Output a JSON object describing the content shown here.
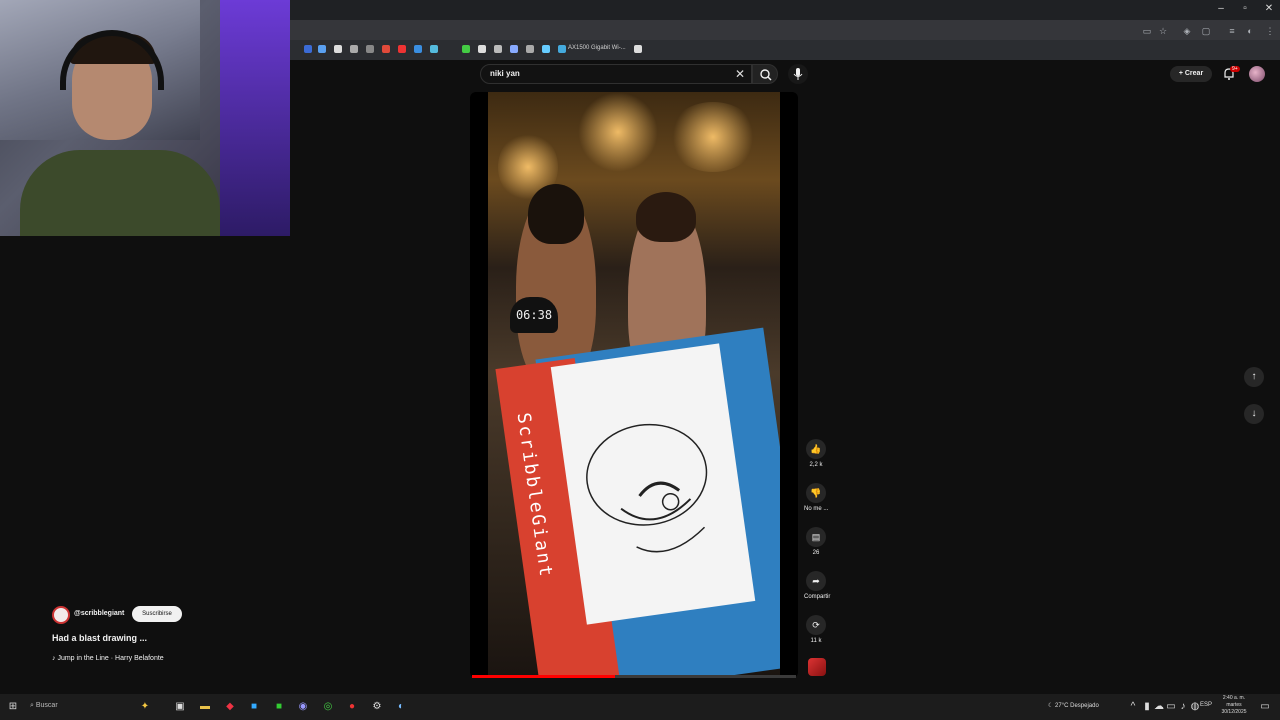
{
  "bookmarks": {
    "label": "AX1500 Gigabit Wi-..."
  },
  "search": {
    "value": "niki yan"
  },
  "header": {
    "create_label": "Crear",
    "notif_count": "9+"
  },
  "video": {
    "banner_text": "ScribbleGiant",
    "timer": "06:38",
    "progress": 0.44
  },
  "actions": {
    "likes": "2,2 k",
    "dislike": "No me ...",
    "comments": "26",
    "share": "Compartir",
    "remix": "11 k"
  },
  "channel": {
    "handle": "@scribblegiant",
    "subscribe": "Suscribirse",
    "title": "Had a blast drawing",
    "more": "...",
    "music": "Jump in the Line · Harry Belafonte"
  },
  "taskbar": {
    "search_label": "Buscar",
    "weather": "27°C  Despejado",
    "lang": "ESP",
    "time": "2:40 a. m.",
    "day": "martes",
    "date": "30/12/2025"
  }
}
